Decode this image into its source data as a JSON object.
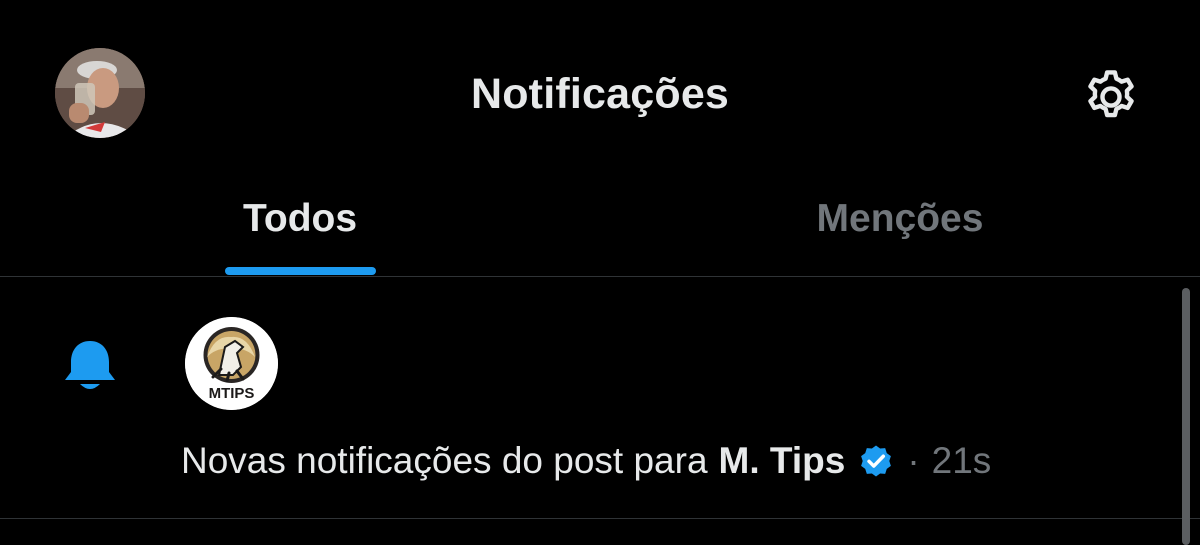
{
  "header": {
    "title": "Notificações",
    "avatar_icon": "user-avatar-photo",
    "settings_icon": "gear-icon"
  },
  "tabs": [
    {
      "label": "Todos",
      "active": true
    },
    {
      "label": "Menções",
      "active": false
    }
  ],
  "notifications": [
    {
      "icon": "bell-icon",
      "avatar_text": "MTIPS",
      "text": "Novas notificações do post para",
      "account": "M. Tips",
      "verified": true,
      "separator": "·",
      "time": "21s"
    }
  ],
  "colors": {
    "background": "#000000",
    "text": "#e7e9ea",
    "muted": "#71767b",
    "accent": "#1d9bf0",
    "divider": "#2f3336"
  }
}
